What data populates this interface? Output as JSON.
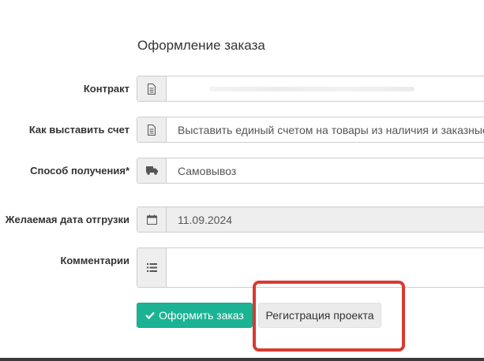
{
  "form": {
    "title": "Оформление заказа",
    "contract": {
      "label": "Контракт",
      "value": "",
      "icon": "document-icon"
    },
    "invoice": {
      "label": "Как выставить счет",
      "value": "Выставить единый счетом на товары из наличия и заказные",
      "icon": "document-icon"
    },
    "delivery": {
      "label": "Способ получения*",
      "value": "Самовывоз",
      "icon": "truck-icon"
    },
    "ship_date": {
      "label": "Желаемая дата отгрузки",
      "value": "11.09.2024",
      "icon": "calendar-icon"
    },
    "comments": {
      "label": "Комментарии",
      "value": "",
      "icon": "list-icon"
    }
  },
  "actions": {
    "submit_label": "Оформить заказ",
    "submit_icon": "check-icon",
    "register_label": "Регистрация проекта"
  },
  "colors": {
    "primary": "#1bb394",
    "highlight": "#d93a2f",
    "addon": "#eeeeee"
  }
}
